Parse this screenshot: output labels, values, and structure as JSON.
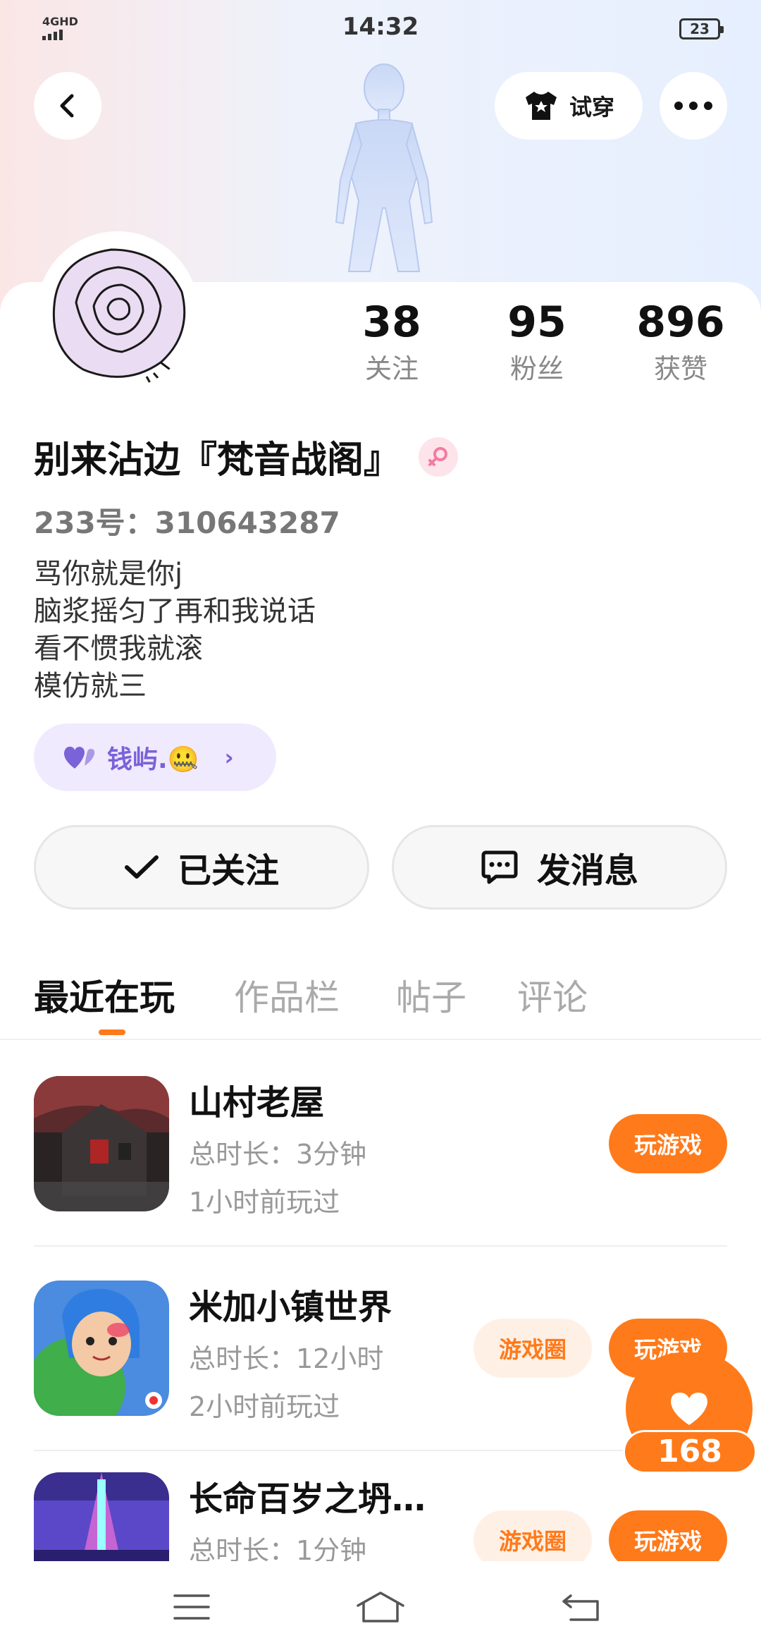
{
  "status_bar": {
    "network": "4GHD",
    "time": "14:32",
    "battery": "23"
  },
  "header": {
    "try_on_label": "试穿"
  },
  "profile": {
    "stats": [
      {
        "value": "38",
        "label": "关注"
      },
      {
        "value": "95",
        "label": "粉丝"
      },
      {
        "value": "896",
        "label": "获赞"
      }
    ],
    "nickname": "别来沾边『梵音战阁』",
    "uid": "233号：310643287",
    "bio": [
      "骂你就是你j",
      "脑浆摇匀了再和我说话",
      "看不惯我就滚",
      "模仿就三"
    ],
    "partner": {
      "name": "钱屿.🤐"
    }
  },
  "actions": {
    "follow_label": "已关注",
    "message_label": "发消息"
  },
  "tabs": [
    {
      "label": "最近在玩",
      "active": true
    },
    {
      "label": "作品栏",
      "active": false
    },
    {
      "label": "帖子",
      "active": false
    },
    {
      "label": "评论",
      "active": false
    }
  ],
  "games": [
    {
      "title": "山村老屋",
      "duration": "总时长：3分钟",
      "last_played": "1小时前玩过",
      "play_label": "玩游戏"
    },
    {
      "title": "米加小镇世界",
      "duration": "总时长：12小时",
      "last_played": "2小时前玩过",
      "circle_label": "游戏圈",
      "play_label": "玩游戏"
    },
    {
      "title": "长命百岁之坍…",
      "duration": "总时长：1分钟",
      "circle_label": "游戏圈",
      "play_label": "玩游戏"
    }
  ],
  "like_fab": {
    "count": "168"
  },
  "colors": {
    "accent": "#ff7a1a",
    "partner": "#7a62d8"
  }
}
